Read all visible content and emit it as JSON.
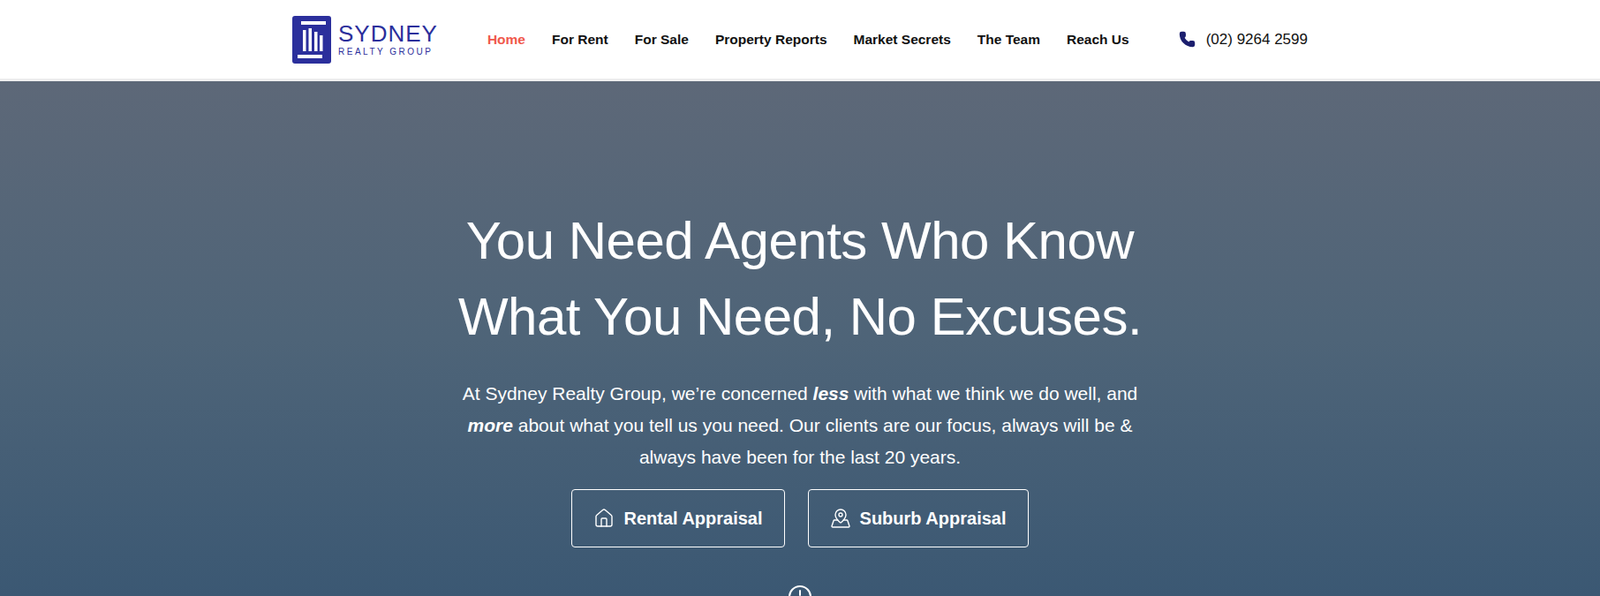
{
  "header": {
    "logo": {
      "name": "SYDNEY",
      "tagline": "REALTY GROUP"
    },
    "nav": [
      {
        "label": "Home",
        "selected": true
      },
      {
        "label": "For Rent",
        "selected": false
      },
      {
        "label": "For Sale",
        "selected": false
      },
      {
        "label": "Property Reports",
        "selected": false
      },
      {
        "label": "Market Secrets",
        "selected": false
      },
      {
        "label": "The Team",
        "selected": false
      },
      {
        "label": "Reach Us",
        "selected": false
      }
    ],
    "phone": "(02) 9264 2599"
  },
  "hero": {
    "heading_lines": [
      "You Need Agents Who Know",
      "What You Need, No Excuses."
    ],
    "intro": [
      {
        "text": "At Sydney Realty Group, we’re concerned ",
        "emphasis": false
      },
      {
        "text": "less",
        "emphasis": true
      },
      {
        "text": " with what we think we do well, and ",
        "emphasis": false
      },
      {
        "text": "more",
        "emphasis": true
      },
      {
        "text": " about what you tell us you need. Our clients are our focus, always will be & always have been for the last 20 years.",
        "emphasis": false
      }
    ],
    "buttons": [
      "Rental Appraisal",
      "Suburb Appraisal"
    ]
  }
}
